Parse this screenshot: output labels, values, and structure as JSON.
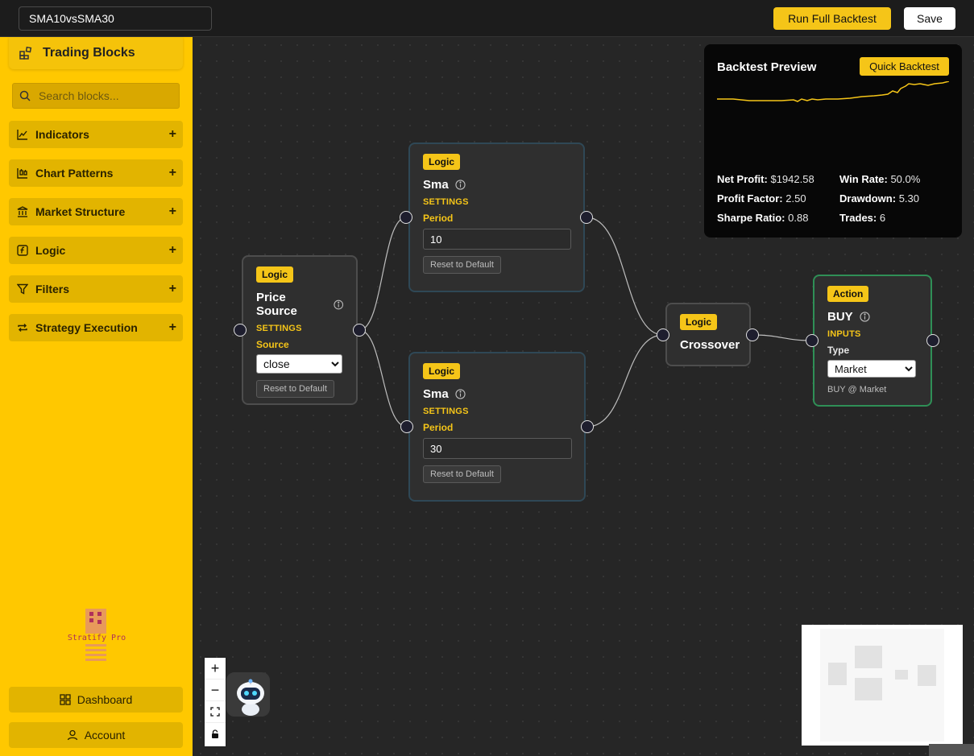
{
  "topbar": {
    "strategy_name": "SMA10vsSMA30",
    "run_full_backtest": "Run Full Backtest",
    "save": "Save"
  },
  "sidebar": {
    "title": "Trading Blocks",
    "search_placeholder": "Search blocks...",
    "categories": [
      {
        "label": "Indicators",
        "icon": "chart-line-icon"
      },
      {
        "label": "Chart Patterns",
        "icon": "candlestick-icon"
      },
      {
        "label": "Market Structure",
        "icon": "bank-icon"
      },
      {
        "label": "Logic",
        "icon": "function-icon"
      },
      {
        "label": "Filters",
        "icon": "filter-icon"
      },
      {
        "label": "Strategy Execution",
        "icon": "repeat-icon"
      }
    ],
    "expand_symbol": "+",
    "logo_text": "Stratify Pro",
    "dashboard": "Dashboard",
    "account": "Account"
  },
  "nodes": {
    "price_source": {
      "badge": "Logic",
      "title": "Price Source",
      "section": "SETTINGS",
      "field_label": "Source",
      "value": "close",
      "options": [
        "close"
      ],
      "reset": "Reset to Default"
    },
    "sma_top": {
      "badge": "Logic",
      "title": "Sma",
      "section": "SETTINGS",
      "field_label": "Period",
      "value": "10",
      "reset": "Reset to Default"
    },
    "sma_bottom": {
      "badge": "Logic",
      "title": "Sma",
      "section": "SETTINGS",
      "field_label": "Period",
      "value": "30",
      "reset": "Reset to Default"
    },
    "crossover": {
      "badge": "Logic",
      "title": "Crossover"
    },
    "buy": {
      "badge": "Action",
      "title": "BUY",
      "section": "INPUTS",
      "field_label": "Type",
      "value": "Market",
      "options": [
        "Market"
      ],
      "summary": "BUY @ Market"
    }
  },
  "preview": {
    "title": "Backtest Preview",
    "quick_backtest": "Quick Backtest",
    "line_color": "#f5c518",
    "stats": {
      "net_profit_label": "Net Profit:",
      "net_profit": "$1942.58",
      "win_rate_label": "Win Rate:",
      "win_rate": "50.0%",
      "profit_factor_label": "Profit Factor:",
      "profit_factor": "2.50",
      "drawdown_label": "Drawdown:",
      "drawdown": "5.30",
      "sharpe_label": "Sharpe Ratio:",
      "sharpe": "0.88",
      "trades_label": "Trades:",
      "trades": "6"
    }
  },
  "controls": {
    "zoom_in": "+",
    "zoom_out": "−"
  },
  "colors": {
    "accent": "#f5c518",
    "sidebar": "#ffc800",
    "canvas": "#262626",
    "action_border": "#2f8f56"
  }
}
